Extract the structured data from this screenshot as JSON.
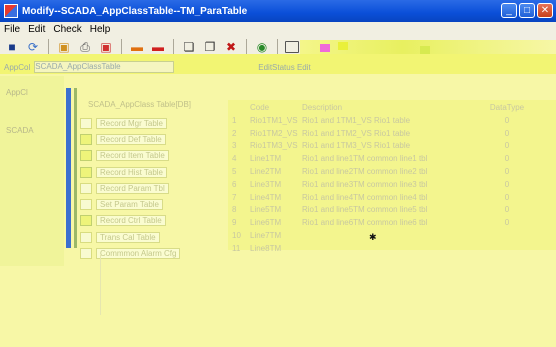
{
  "window": {
    "title": "Modify--SCADA_AppClassTable--TM_ParaTable",
    "buttons": {
      "minimize": "_",
      "maximize": "□",
      "close": "✕"
    }
  },
  "menu": [
    "File",
    "Edit",
    "Check",
    "Help"
  ],
  "toolbar": {
    "icons": [
      "save-icon",
      "refresh-icon",
      "lock-icon",
      "print-icon",
      "stop-icon",
      "insert-row-icon",
      "delete-row-icon",
      "copy-icon",
      "paste-icon",
      "delete-icon",
      "help-icon",
      "checkbox-icon"
    ],
    "tail_text": "Cl"
  },
  "combo_row": {
    "left_label": "AppCol",
    "combo_value": "SCADA_AppClassTable",
    "right_label": "EditStatus Edit"
  },
  "left_pane": {
    "header": "AppCl",
    "item": "SCADA"
  },
  "tree": {
    "root": "SCADA_AppClass Table[DB]",
    "items": [
      "Record Mgr Table",
      "Record Def Table",
      "Record Item Table",
      "Record Hist Table",
      "Record Param Tbl",
      "Set Param Table",
      "Record Ctrl Table",
      "Trans Cal Table",
      "Commmon Alarm Cfg"
    ]
  },
  "grid": {
    "columns": [
      "",
      "Code",
      "Description",
      "DataType",
      ""
    ],
    "rows": [
      [
        "1",
        "Rio1TM1_VS",
        "Rio1 and 1TM1_VS Rio1 table",
        "0",
        ""
      ],
      [
        "2",
        "Rio1TM2_VS",
        "Rio1 and 1TM2_VS Rio1 table",
        "0",
        ""
      ],
      [
        "3",
        "Rio1TM3_VS",
        "Rio1 and 1TM3_VS Rio1 table",
        "0",
        ""
      ],
      [
        "4",
        "Line1TM",
        "Rio1 and line1TM common line1 tbl",
        "0",
        ""
      ],
      [
        "5",
        "Line2TM",
        "Rio1 and line2TM common line2 tbl",
        "0",
        ""
      ],
      [
        "6",
        "Line3TM",
        "Rio1 and line3TM common line3 tbl",
        "0",
        ""
      ],
      [
        "7",
        "Line4TM",
        "Rio1 and line4TM common line4 tbl",
        "0",
        ""
      ],
      [
        "8",
        "Line5TM",
        "Rio1 and line5TM common line5 tbl",
        "0",
        ""
      ],
      [
        "9",
        "Line6TM",
        "Rio1 and line6TM common line6 tbl",
        "0",
        ""
      ],
      [
        "10",
        "Line7TM",
        "",
        "",
        ""
      ],
      [
        "11",
        "Line8TM",
        "",
        "",
        ""
      ]
    ]
  },
  "colors": {
    "titlebar": "#0a4fd8",
    "menubar": "#f1efe2",
    "overlay": "#f7f7a6",
    "accent_blue": "#3b6fd0"
  }
}
